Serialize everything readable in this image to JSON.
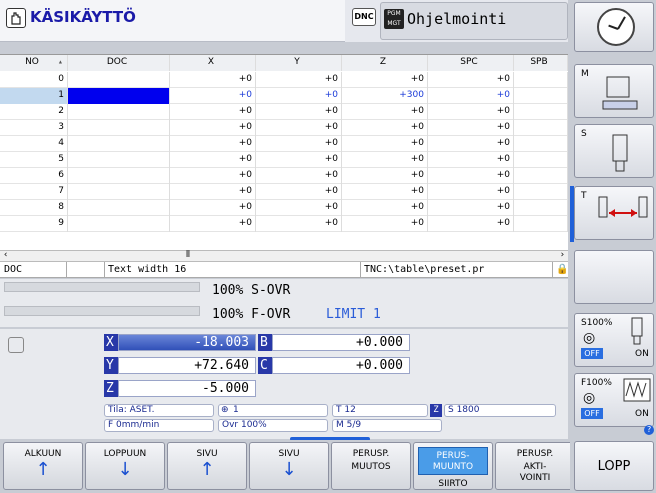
{
  "header": {
    "mode_title": "KÄSIKÄYTTÖ",
    "dnc": "DNC",
    "pgm_icon": "PGM MGT",
    "program_mode": "Ohjelmointi"
  },
  "table": {
    "columns": [
      "NO",
      "DOC",
      "X",
      "Y",
      "Z",
      "SPC",
      "SPB"
    ],
    "rows": [
      {
        "no": "0",
        "doc": "",
        "x": "+0",
        "y": "+0",
        "z": "+0",
        "spc": "+0"
      },
      {
        "no": "1",
        "doc": "",
        "x": "+0",
        "y": "+0",
        "z": "+300",
        "spc": "+0"
      },
      {
        "no": "2",
        "doc": "",
        "x": "+0",
        "y": "+0",
        "z": "+0",
        "spc": "+0"
      },
      {
        "no": "3",
        "doc": "",
        "x": "+0",
        "y": "+0",
        "z": "+0",
        "spc": "+0"
      },
      {
        "no": "4",
        "doc": "",
        "x": "+0",
        "y": "+0",
        "z": "+0",
        "spc": "+0"
      },
      {
        "no": "5",
        "doc": "",
        "x": "+0",
        "y": "+0",
        "z": "+0",
        "spc": "+0"
      },
      {
        "no": "6",
        "doc": "",
        "x": "+0",
        "y": "+0",
        "z": "+0",
        "spc": "+0"
      },
      {
        "no": "7",
        "doc": "",
        "x": "+0",
        "y": "+0",
        "z": "+0",
        "spc": "+0"
      },
      {
        "no": "8",
        "doc": "",
        "x": "+0",
        "y": "+0",
        "z": "+0",
        "spc": "+0"
      },
      {
        "no": "9",
        "doc": "",
        "x": "+0",
        "y": "+0",
        "z": "+0",
        "spc": "+0"
      }
    ],
    "selected_row": 1
  },
  "status": {
    "field": "DOC",
    "width": "Text width 16",
    "file": "TNC:\\table\\preset.pr"
  },
  "override": {
    "s_ovr": "100% S-OVR",
    "f_ovr": "100% F-OVR",
    "limit": "LIMIT 1"
  },
  "position": {
    "X": "-18.003",
    "Y": "+72.640",
    "Z": "-5.000",
    "B": "+0.000",
    "C": "+0.000",
    "labels": {
      "x": "X",
      "y": "Y",
      "z": "Z",
      "b": "B",
      "c": "C"
    }
  },
  "info": {
    "tila": "Tila: ASET.",
    "feed": "F 0mm/min",
    "tool_num": "1",
    "ovr": "Ovr 100%",
    "tool": "T 12",
    "z_label": "Z",
    "speed": "S 1800",
    "m": "M 5/9"
  },
  "softkeys": [
    {
      "line1": "ALKUUN",
      "line2": "",
      "arrow": "↑"
    },
    {
      "line1": "LOPPUUN",
      "line2": "",
      "arrow": "↓"
    },
    {
      "line1": "SIVU",
      "line2": "",
      "arrow": "↑"
    },
    {
      "line1": "SIVU",
      "line2": "",
      "arrow": "↓"
    },
    {
      "line1": "PERUSP.",
      "line2": "MUUTOS",
      "arrow": ""
    },
    {
      "line1": "PERUS-\nMUUNTO",
      "line2": "SIIRTO",
      "arrow": ""
    },
    {
      "line1": "PERUSP.",
      "line2": "AKTI-\nVOINTI",
      "arrow": ""
    },
    {
      "line1": "LOPP",
      "line2": "",
      "arrow": ""
    }
  ],
  "side": {
    "m_label": "M",
    "s_label": "S",
    "t_label": "T",
    "s100": "S100%",
    "f100": "F100%",
    "off": "OFF",
    "on": "ON",
    "help": "?"
  }
}
